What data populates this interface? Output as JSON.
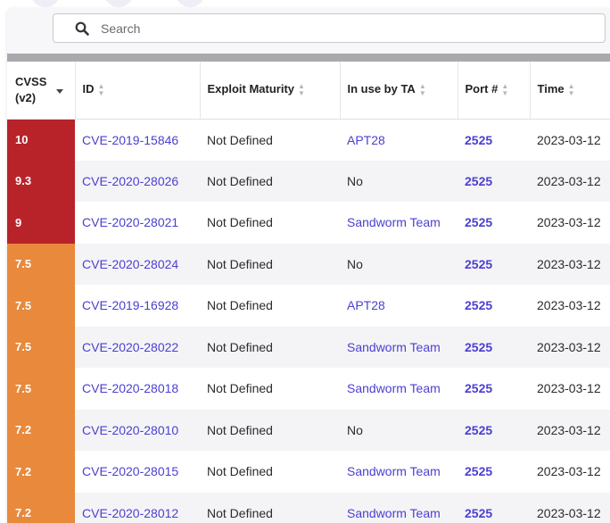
{
  "search": {
    "placeholder": "Search"
  },
  "table": {
    "columns": {
      "cvss": "CVSS (v2)",
      "id": "ID",
      "exploit": "Exploit Maturity",
      "ta": "In use by TA",
      "port": "Port #",
      "time": "Time"
    },
    "rows": [
      {
        "cvss": "10",
        "id": "CVE-2019-15846",
        "exploit": "Not Defined",
        "ta": "APT28",
        "port": "2525",
        "time": "2023-03-12",
        "severity": "critical"
      },
      {
        "cvss": "9.3",
        "id": "CVE-2020-28026",
        "exploit": "Not Defined",
        "ta": "No",
        "port": "2525",
        "time": "2023-03-12",
        "severity": "critical"
      },
      {
        "cvss": "9",
        "id": "CVE-2020-28021",
        "exploit": "Not Defined",
        "ta": "Sandworm Team",
        "port": "2525",
        "time": "2023-03-12",
        "severity": "critical"
      },
      {
        "cvss": "7.5",
        "id": "CVE-2020-28024",
        "exploit": "Not Defined",
        "ta": "No",
        "port": "2525",
        "time": "2023-03-12",
        "severity": "high"
      },
      {
        "cvss": "7.5",
        "id": "CVE-2019-16928",
        "exploit": "Not Defined",
        "ta": "APT28",
        "port": "2525",
        "time": "2023-03-12",
        "severity": "high"
      },
      {
        "cvss": "7.5",
        "id": "CVE-2020-28022",
        "exploit": "Not Defined",
        "ta": "Sandworm Team",
        "port": "2525",
        "time": "2023-03-12",
        "severity": "high"
      },
      {
        "cvss": "7.5",
        "id": "CVE-2020-28018",
        "exploit": "Not Defined",
        "ta": "Sandworm Team",
        "port": "2525",
        "time": "2023-03-12",
        "severity": "high"
      },
      {
        "cvss": "7.2",
        "id": "CVE-2020-28010",
        "exploit": "Not Defined",
        "ta": "No",
        "port": "2525",
        "time": "2023-03-12",
        "severity": "high"
      },
      {
        "cvss": "7.2",
        "id": "CVE-2020-28015",
        "exploit": "Not Defined",
        "ta": "Sandworm Team",
        "port": "2525",
        "time": "2023-03-12",
        "severity": "high"
      },
      {
        "cvss": "7.2",
        "id": "CVE-2020-28012",
        "exploit": "Not Defined",
        "ta": "Sandworm Team",
        "port": "2525",
        "time": "2023-03-12",
        "severity": "high"
      }
    ]
  },
  "colors": {
    "critical": "#b8232a",
    "high": "#e8893c",
    "link": "#4b3fd0",
    "header_bar": "#a9a9ad"
  },
  "icons": {
    "search": "search-icon",
    "sort": "sort-icon",
    "sort_desc": "sort-desc-icon"
  }
}
